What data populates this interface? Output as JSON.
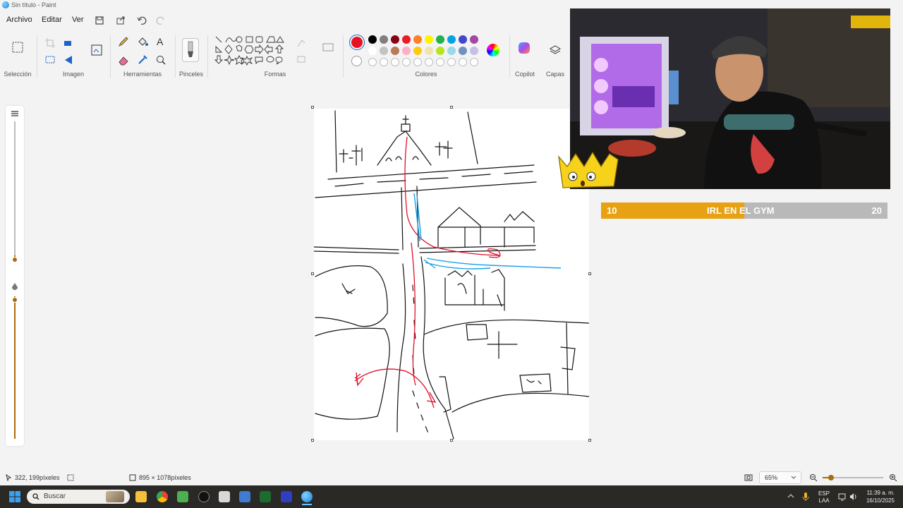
{
  "window": {
    "title": "Sin título - Paint"
  },
  "menu": [
    "Archivo",
    "Editar",
    "Ver"
  ],
  "ribbon": {
    "groups": [
      "Selección",
      "Imagen",
      "Herramientas",
      "Pinceles",
      "Formas",
      "Colores",
      "Copilot",
      "Capas"
    ],
    "primary_color": "#e81123",
    "palette_row1": [
      "#000000",
      "#7f7f7f",
      "#880015",
      "#ed1c24",
      "#ff7f27",
      "#fff200",
      "#22b14c",
      "#00a2e8",
      "#3f48cc",
      "#a349a4"
    ],
    "palette_row2": [
      "#ffffff",
      "#c3c3c3",
      "#b97a57",
      "#ffaec9",
      "#ffc90e",
      "#efe4b0",
      "#b5e61d",
      "#99d9ea",
      "#7092be",
      "#c8bfe7"
    ]
  },
  "overlay": {
    "bar_left": "10",
    "bar_title": "IRL EN EL GYM",
    "bar_right": "20",
    "bar_progress": 0.5
  },
  "status": {
    "cursor_pos": "322, 199píxeles",
    "canvas_size": "895 × 1078píxeles",
    "zoom": "65%"
  },
  "taskbar": {
    "search_placeholder": "Buscar",
    "lang_top": "ESP",
    "lang_bottom": "LAA",
    "time": "11:39 a. m.",
    "date": "16/10/2025"
  },
  "colors": {
    "accent": "#e8a112",
    "taskbar": "#2a2926"
  }
}
